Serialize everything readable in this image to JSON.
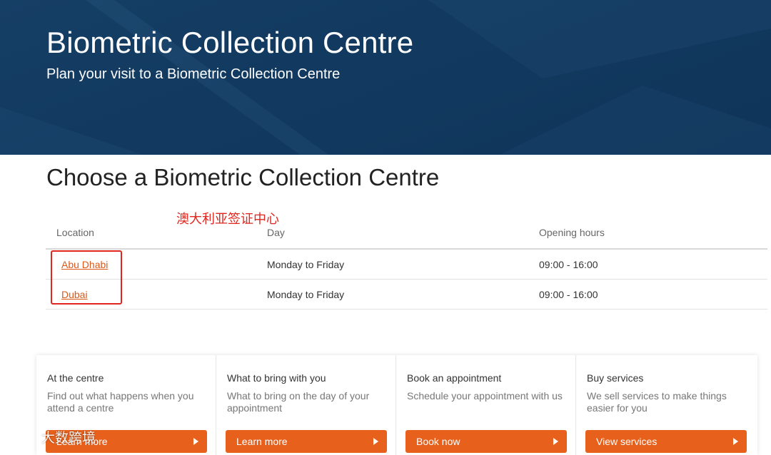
{
  "hero": {
    "title": "Biometric Collection Centre",
    "subtitle": "Plan your visit to a Biometric Collection Centre"
  },
  "section": {
    "title": "Choose a Biometric Collection Centre"
  },
  "annotation": {
    "text": "澳大利亚签证中心",
    "color": "#e0261e"
  },
  "table": {
    "headers": [
      "Location",
      "Day",
      "Opening hours"
    ],
    "rows": [
      {
        "location": "Abu Dhabi",
        "day": "Monday to Friday",
        "hours": "09:00 - 16:00"
      },
      {
        "location": "Dubai",
        "day": "Monday to Friday",
        "hours": "09:00 - 16:00"
      }
    ]
  },
  "cards": [
    {
      "title": "At the centre",
      "description": "Find out what happens when you attend a centre",
      "button": "Learn more"
    },
    {
      "title": "What to bring with you",
      "description": "What to bring on the day of your appointment",
      "button": "Learn more"
    },
    {
      "title": "Book an appointment",
      "description": "Schedule your appointment with us",
      "button": "Book now"
    },
    {
      "title": "Buy services",
      "description": "We sell services to make things easier for you",
      "button": "View services"
    }
  ],
  "watermark": {
    "text": "大数跨境"
  },
  "colors": {
    "hero_bg": "#123a60",
    "accent_orange": "#e8611c",
    "link_orange": "#d9591b",
    "annotation_red": "#e0261e"
  }
}
